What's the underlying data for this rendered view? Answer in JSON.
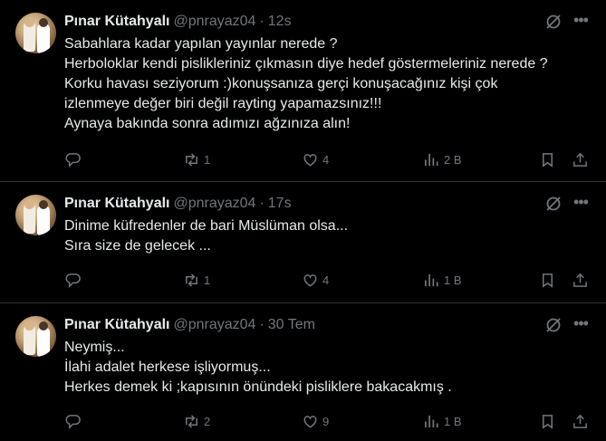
{
  "tweets": [
    {
      "author": "Pınar Kütahyalı",
      "handle": "@pnrayaz04",
      "separator": "·",
      "time": "12s",
      "lines": [
        "Sabahlara kadar yapılan yayınlar nerede ?",
        "Herboloklar  kendi pislikleriniz çıkmasın diye hedef göstermeleriniz nerede ?",
        "Korku havası seziyorum :)konuşsanıza gerçi konuşacağınız kişi çok",
        "izlenmeye değer biri değil rayting yapamazsınız!!!",
        "Aynaya bakında sonra adımızı ağzınıza alın!"
      ],
      "reposts": "1",
      "likes": "4",
      "views": "2 B"
    },
    {
      "author": "Pınar Kütahyalı",
      "handle": "@pnrayaz04",
      "separator": "·",
      "time": "17s",
      "lines": [
        "Dinime küfredenler de  bari Müslüman olsa...",
        "Sıra size de gelecek ..."
      ],
      "reposts": "1",
      "likes": "4",
      "views": "1 B"
    },
    {
      "author": "Pınar Kütahyalı",
      "handle": "@pnrayaz04",
      "separator": "·",
      "time": "30 Tem",
      "lines": [
        "Neymiş...",
        "İlahi adalet herkese işliyormuş...",
        "Herkes demek ki ;kapısının önündeki pisliklere bakacakmış ."
      ],
      "reposts": "2",
      "likes": "9",
      "views": "1 B"
    }
  ],
  "icons": {
    "reply": "reply-icon",
    "repost": "repost-icon",
    "like": "heart-icon",
    "views": "views-icon",
    "bookmark": "bookmark-icon",
    "share": "share-icon",
    "grok": "grok-icon",
    "more": "more-icon"
  },
  "colors": {
    "background": "#000000",
    "text": "#e7e9ea",
    "muted": "#71767b",
    "divider": "#2f3336"
  }
}
